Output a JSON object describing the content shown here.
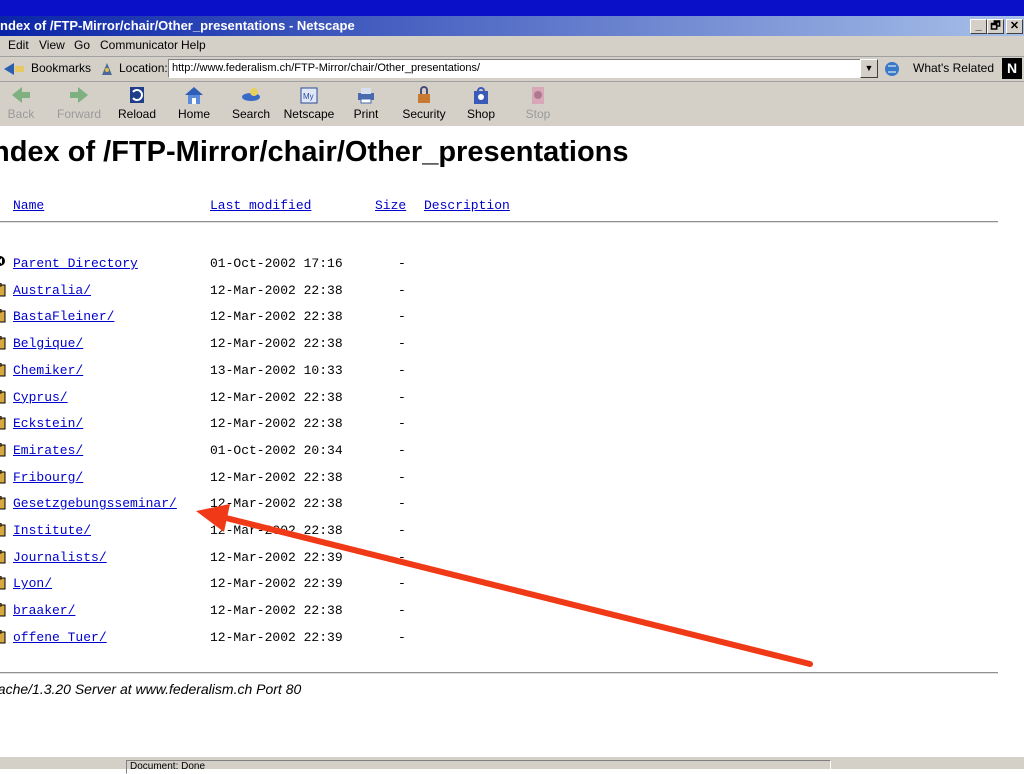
{
  "window": {
    "title": "ndex of /FTP-Mirror/chair/Other_presentations - Netscape",
    "min_label": "_",
    "max_label": "🗗",
    "close_label": "✕"
  },
  "menu": {
    "items": [
      "Edit",
      "View",
      "Go",
      "Communicator",
      "Help"
    ]
  },
  "location": {
    "bookmarks_label": "Bookmarks",
    "location_label": "Location:",
    "url": "http://www.federalism.ch/FTP-Mirror/chair/Other_presentations/",
    "whats_related_label": "What's Related",
    "netscape_logo": "N"
  },
  "toolbar": {
    "buttons": [
      {
        "label": "Back",
        "icon": "back-arrow-icon",
        "enabled": false
      },
      {
        "label": "Forward",
        "icon": "forward-arrow-icon",
        "enabled": false
      },
      {
        "label": "Reload",
        "icon": "reload-icon",
        "enabled": true
      },
      {
        "label": "Home",
        "icon": "home-icon",
        "enabled": true
      },
      {
        "label": "Search",
        "icon": "search-icon",
        "enabled": true
      },
      {
        "label": "Netscape",
        "icon": "netscape-icon",
        "enabled": true
      },
      {
        "label": "Print",
        "icon": "print-icon",
        "enabled": true
      },
      {
        "label": "Security",
        "icon": "security-lock-icon",
        "enabled": true
      },
      {
        "label": "Shop",
        "icon": "shop-bag-icon",
        "enabled": true
      },
      {
        "label": "Stop",
        "icon": "stop-icon",
        "enabled": false
      }
    ]
  },
  "page": {
    "heading": "ndex of /FTP-Mirror/chair/Other_presentations",
    "columns": {
      "name": "Name",
      "last_modified": "Last modified",
      "size": "Size",
      "description": "Description"
    },
    "rows": [
      {
        "name": "Parent Directory",
        "date": "01-Oct-2002 17:16",
        "size": "-",
        "icon": "back-icon"
      },
      {
        "name": "Australia/",
        "date": "12-Mar-2002 22:38",
        "size": "-",
        "icon": "folder-icon"
      },
      {
        "name": "BastaFleiner/",
        "date": "12-Mar-2002 22:38",
        "size": "-",
        "icon": "folder-icon"
      },
      {
        "name": "Belgique/",
        "date": "12-Mar-2002 22:38",
        "size": "-",
        "icon": "folder-icon"
      },
      {
        "name": "Chemiker/",
        "date": "13-Mar-2002 10:33",
        "size": "-",
        "icon": "folder-icon"
      },
      {
        "name": "Cyprus/",
        "date": "12-Mar-2002 22:38",
        "size": "-",
        "icon": "folder-icon"
      },
      {
        "name": "Eckstein/",
        "date": "12-Mar-2002 22:38",
        "size": "-",
        "icon": "folder-icon"
      },
      {
        "name": "Emirates/",
        "date": "01-Oct-2002 20:34",
        "size": "-",
        "icon": "folder-icon"
      },
      {
        "name": "Fribourg/",
        "date": "12-Mar-2002 22:38",
        "size": "-",
        "icon": "folder-icon"
      },
      {
        "name": "Gesetzgebungsseminar/",
        "date": "12-Mar-2002 22:38",
        "size": "-",
        "icon": "folder-icon"
      },
      {
        "name": "Institute/",
        "date": "12-Mar-2002 22:38",
        "size": "-",
        "icon": "folder-icon"
      },
      {
        "name": "Journalists/",
        "date": "12-Mar-2002 22:39",
        "size": "-",
        "icon": "folder-icon"
      },
      {
        "name": "Lyon/",
        "date": "12-Mar-2002 22:39",
        "size": "-",
        "icon": "folder-icon"
      },
      {
        "name": "braaker/",
        "date": "12-Mar-2002 22:38",
        "size": "-",
        "icon": "folder-icon"
      },
      {
        "name": "offene Tuer/",
        "date": "12-Mar-2002 22:39",
        "size": "-",
        "icon": "folder-icon"
      }
    ],
    "footer": "pache/1.3.20 Server at www.federalism.ch Port 80"
  },
  "status": {
    "text": "Document: Done"
  },
  "colors": {
    "link": "#0000cc",
    "chrome": "#d4d0c8",
    "titlebar": "#0a0fc8",
    "annotation_arrow": "#f03a17"
  }
}
